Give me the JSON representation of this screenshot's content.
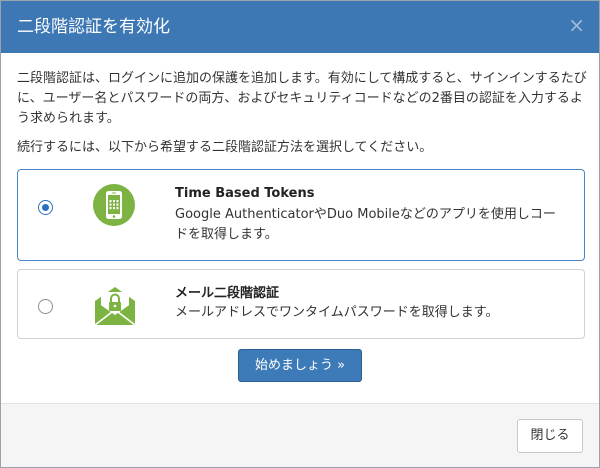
{
  "header": {
    "title": "二段階認証を有効化",
    "close_glyph": "×"
  },
  "intro_text": "二段階認証は、ログインに追加の保護を追加します。有効にして構成すると、サインインするたびに、ユーザー名とパスワードの両方、およびセキュリティコードなどの2番目の認証を入力するよう求められます。",
  "prompt_text": "続行するには、以下から希望する二段階認証方法を選択してください。",
  "options": [
    {
      "title": "Time Based Tokens",
      "description": "Google AuthenticatorやDuo Mobileなどのアプリを使用しコードを取得します。",
      "selected": true,
      "icon": "mobile-phone-icon"
    },
    {
      "title": "メール二段階認証",
      "description": "メールアドレスでワンタイムパスワードを取得します。",
      "selected": false,
      "icon": "mail-lock-icon"
    }
  ],
  "start_button": "始めましょう »",
  "close_button": "閉じる",
  "colors": {
    "header_bg": "#3d78b5",
    "primary_button": "#3d7ab8",
    "icon_green": "#7cb342",
    "selected_border": "#4a86c5"
  }
}
